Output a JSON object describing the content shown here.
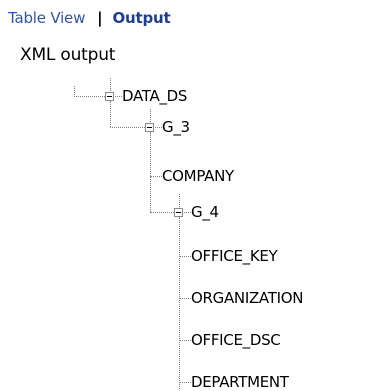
{
  "tabs": {
    "table_view": "Table View",
    "separator": "|",
    "output": "Output"
  },
  "tree": {
    "root": "XML output",
    "data_ds": "DATA_DS",
    "g3": "G_3",
    "company": "COMPANY",
    "g4": "G_4",
    "office_key": "OFFICE_KEY",
    "organization": "ORGANIZATION",
    "office_dsc": "OFFICE_DSC",
    "department": "DEPARTMENT"
  }
}
